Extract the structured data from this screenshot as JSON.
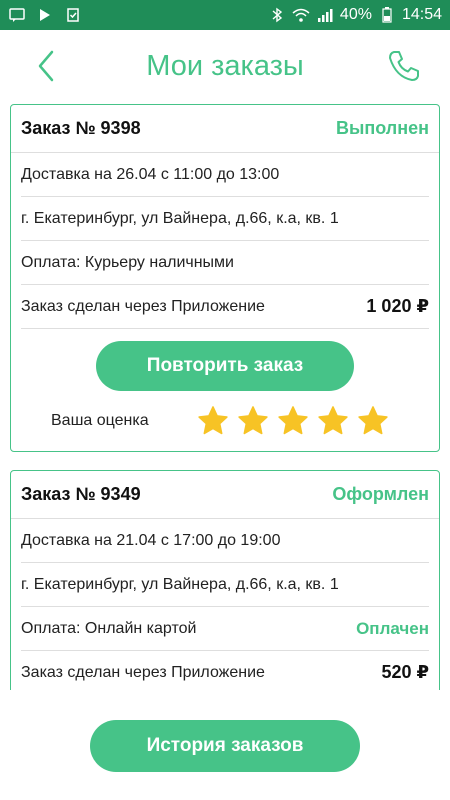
{
  "status_bar": {
    "battery": "40%",
    "time": "14:54"
  },
  "header": {
    "title": "Мои заказы"
  },
  "orders": [
    {
      "number": "Заказ № 9398",
      "status": "Выполнен",
      "delivery": "Доставка на 26.04 с 11:00 до 13:00",
      "address": "г. Екатеринбург, ул Вайнера, д.66, к.а, кв. 1",
      "payment": "Оплата: Курьеру наличными",
      "source": "Заказ сделан через Приложение",
      "amount": "1 020 ₽",
      "repeat_button": "Повторить заказ",
      "rating_label": "Ваша оценка",
      "rating": 5
    },
    {
      "number": "Заказ № 9349",
      "status": "Оформлен",
      "delivery": "Доставка на 21.04 с 17:00 до 19:00",
      "address": "г. Екатеринбург, ул Вайнера, д.66, к.а, кв. 1",
      "payment": "Оплата: Онлайн картой",
      "payment_status": "Оплачен",
      "source": "Заказ сделан через Приложение",
      "amount": "520 ₽"
    }
  ],
  "history_button": "История заказов",
  "colors": {
    "accent": "#46c388",
    "status_bar": "#1f8d58",
    "star": "#f7c325"
  }
}
